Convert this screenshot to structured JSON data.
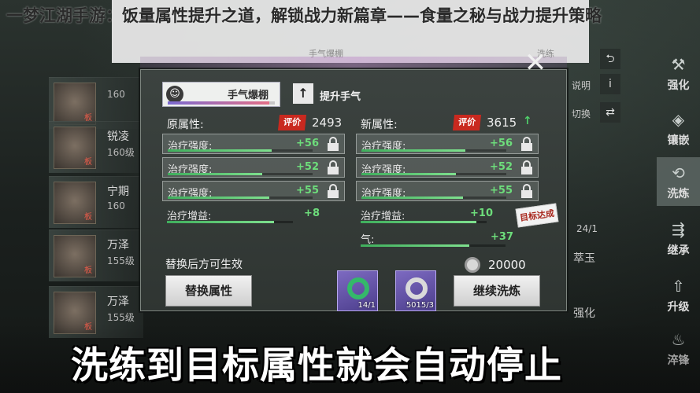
{
  "article_title": "一梦江湖手游：饭量属性提升之道，解锁战力新篇章——食量之秘与战力提升策略",
  "top_bar": {
    "left_text": "手气爆棚",
    "right_text": "洗练"
  },
  "inventory": [
    {
      "name": "",
      "level": "160",
      "tag": "板"
    },
    {
      "name": "锐凌",
      "level": "160级",
      "tag": "板"
    },
    {
      "name": "宁期",
      "level": "160",
      "tag": "板"
    },
    {
      "name": "万泽",
      "level": "155级",
      "tag": "板"
    },
    {
      "name": "万泽",
      "level": "155级",
      "tag": "板"
    }
  ],
  "side_menu": [
    {
      "label": "强化",
      "icon": "hammer-icon",
      "glyph": "⚒"
    },
    {
      "label": "镶嵌",
      "icon": "gem-icon",
      "glyph": "◈"
    },
    {
      "label": "洗炼",
      "icon": "refine-icon",
      "glyph": "⟲"
    },
    {
      "label": "继承",
      "icon": "inherit-icon",
      "glyph": "⇶"
    },
    {
      "label": "升级",
      "icon": "upgrade-icon",
      "glyph": "⇧"
    },
    {
      "label": "淬锋",
      "icon": "forge-icon",
      "glyph": "♨"
    }
  ],
  "right_column": {
    "help_label": "说明",
    "switch_label": "切换",
    "count_label": "24/1",
    "jade_label": "萃玉",
    "strengthen_label": "强化"
  },
  "panel": {
    "luck": {
      "label": "手气爆棚",
      "glyph": "☺",
      "progress": 0.95
    },
    "boost_label": "提升手气",
    "boost_glyph": "↑",
    "original": {
      "title": "原属性:",
      "badge": "评价",
      "score": "2493",
      "rows": [
        {
          "name": "治疗强度:",
          "value": "+56",
          "progress": 0.72
        },
        {
          "name": "治疗强度:",
          "value": "+52",
          "progress": 0.65
        },
        {
          "name": "治疗强度:",
          "value": "+55",
          "progress": 0.7
        }
      ],
      "extra": [
        {
          "name": "治疗增益:",
          "value": "+8",
          "progress": 0.85
        }
      ]
    },
    "new": {
      "title": "新属性:",
      "badge": "评价",
      "score": "3615",
      "arrow": "↑",
      "rows": [
        {
          "name": "治疗强度:",
          "value": "+56",
          "progress": 0.72
        },
        {
          "name": "治疗强度:",
          "value": "+52",
          "progress": 0.65
        },
        {
          "name": "治疗强度:",
          "value": "+55",
          "progress": 0.7
        }
      ],
      "extra": [
        {
          "name": "治疗增益:",
          "value": "+10",
          "progress": 0.92
        },
        {
          "name": "气:",
          "value": "+37",
          "progress": 0.75
        }
      ]
    },
    "sticker": "目标达成",
    "replace_note": "替换后方可生效",
    "replace_button": "替换属性",
    "cost": "20000",
    "continue_button": "继续洗炼",
    "items": [
      {
        "qty": "14/1"
      },
      {
        "qty": "5015/3"
      }
    ],
    "close_glyph": "✕"
  },
  "caption": "洗练到目标属性就会自动停止"
}
